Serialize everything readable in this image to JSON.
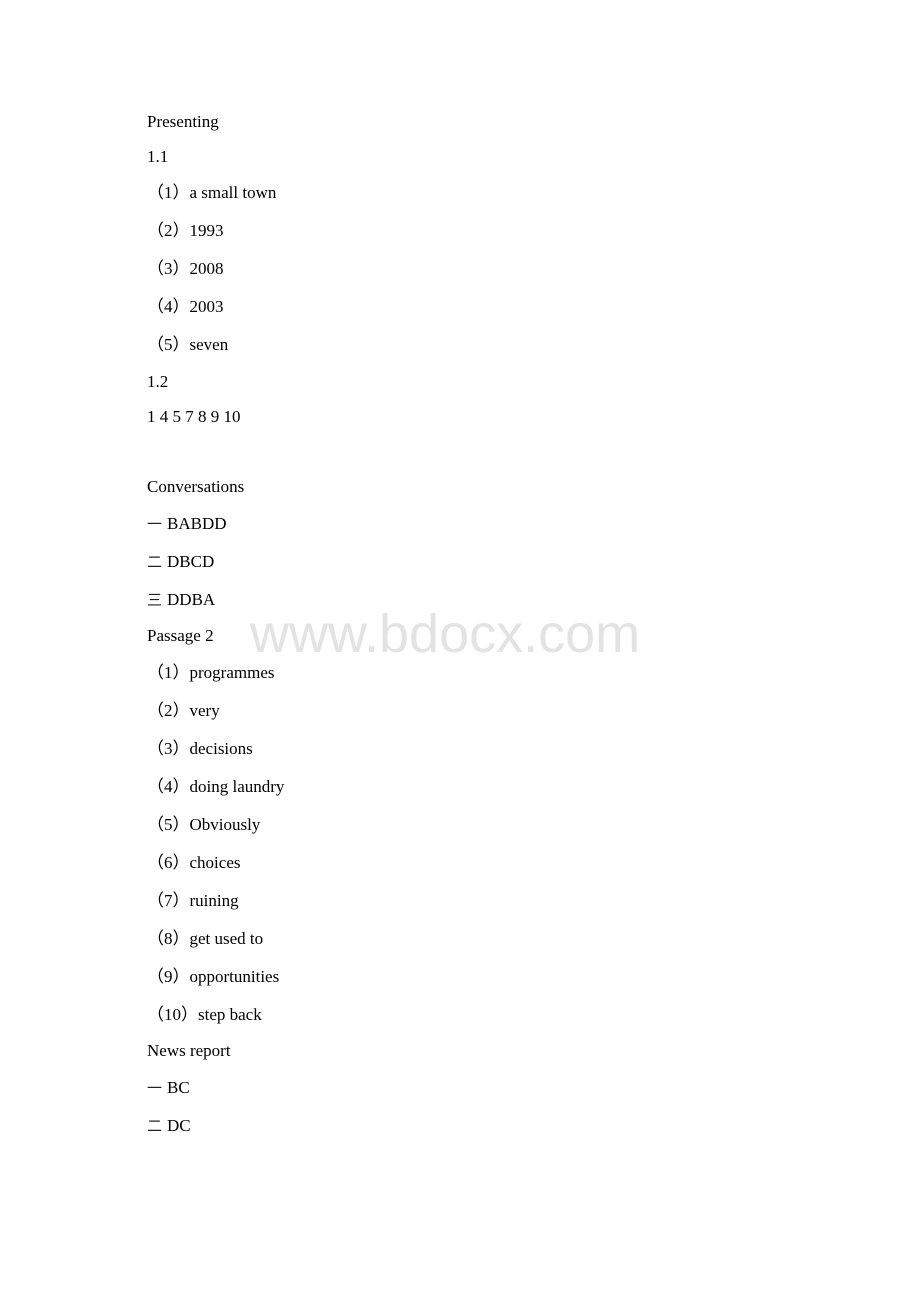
{
  "document": {
    "watermark": "www.bdocx.com",
    "sections": {
      "presenting": {
        "title": "Presenting",
        "sub1": {
          "label": "1.1",
          "items": [
            {
              "num": "（1）",
              "text": "a small town"
            },
            {
              "num": "（2）",
              "text": "1993"
            },
            {
              "num": "（3）",
              "text": "2008"
            },
            {
              "num": "（4）",
              "text": "2003"
            },
            {
              "num": "（5）",
              "text": "seven"
            }
          ]
        },
        "sub2": {
          "label": "1.2",
          "answer": "1 4 5 7 8 9 10"
        }
      },
      "conversations": {
        "title": "Conversations",
        "items": [
          {
            "num": "一",
            "text": "BABDD"
          },
          {
            "num": "二",
            "text": "DBCD"
          },
          {
            "num": "三",
            "text": "DDBA"
          }
        ]
      },
      "passage2": {
        "title": "Passage 2",
        "items": [
          {
            "num": "（1）",
            "text": "programmes"
          },
          {
            "num": "（2）",
            "text": "very"
          },
          {
            "num": "（3）",
            "text": "decisions"
          },
          {
            "num": "（4）",
            "text": "doing laundry"
          },
          {
            "num": "（5）",
            "text": "Obviously"
          },
          {
            "num": "（6）",
            "text": "choices"
          },
          {
            "num": "（7）",
            "text": "ruining"
          },
          {
            "num": "（8）",
            "text": "get used to"
          },
          {
            "num": "（9）",
            "text": "opportunities"
          },
          {
            "num": "（10）",
            "text": "step back"
          }
        ]
      },
      "news_report": {
        "title": "News report",
        "items": [
          {
            "num": "一",
            "text": "BC"
          },
          {
            "num": "二",
            "text": "DC"
          }
        ]
      }
    }
  }
}
